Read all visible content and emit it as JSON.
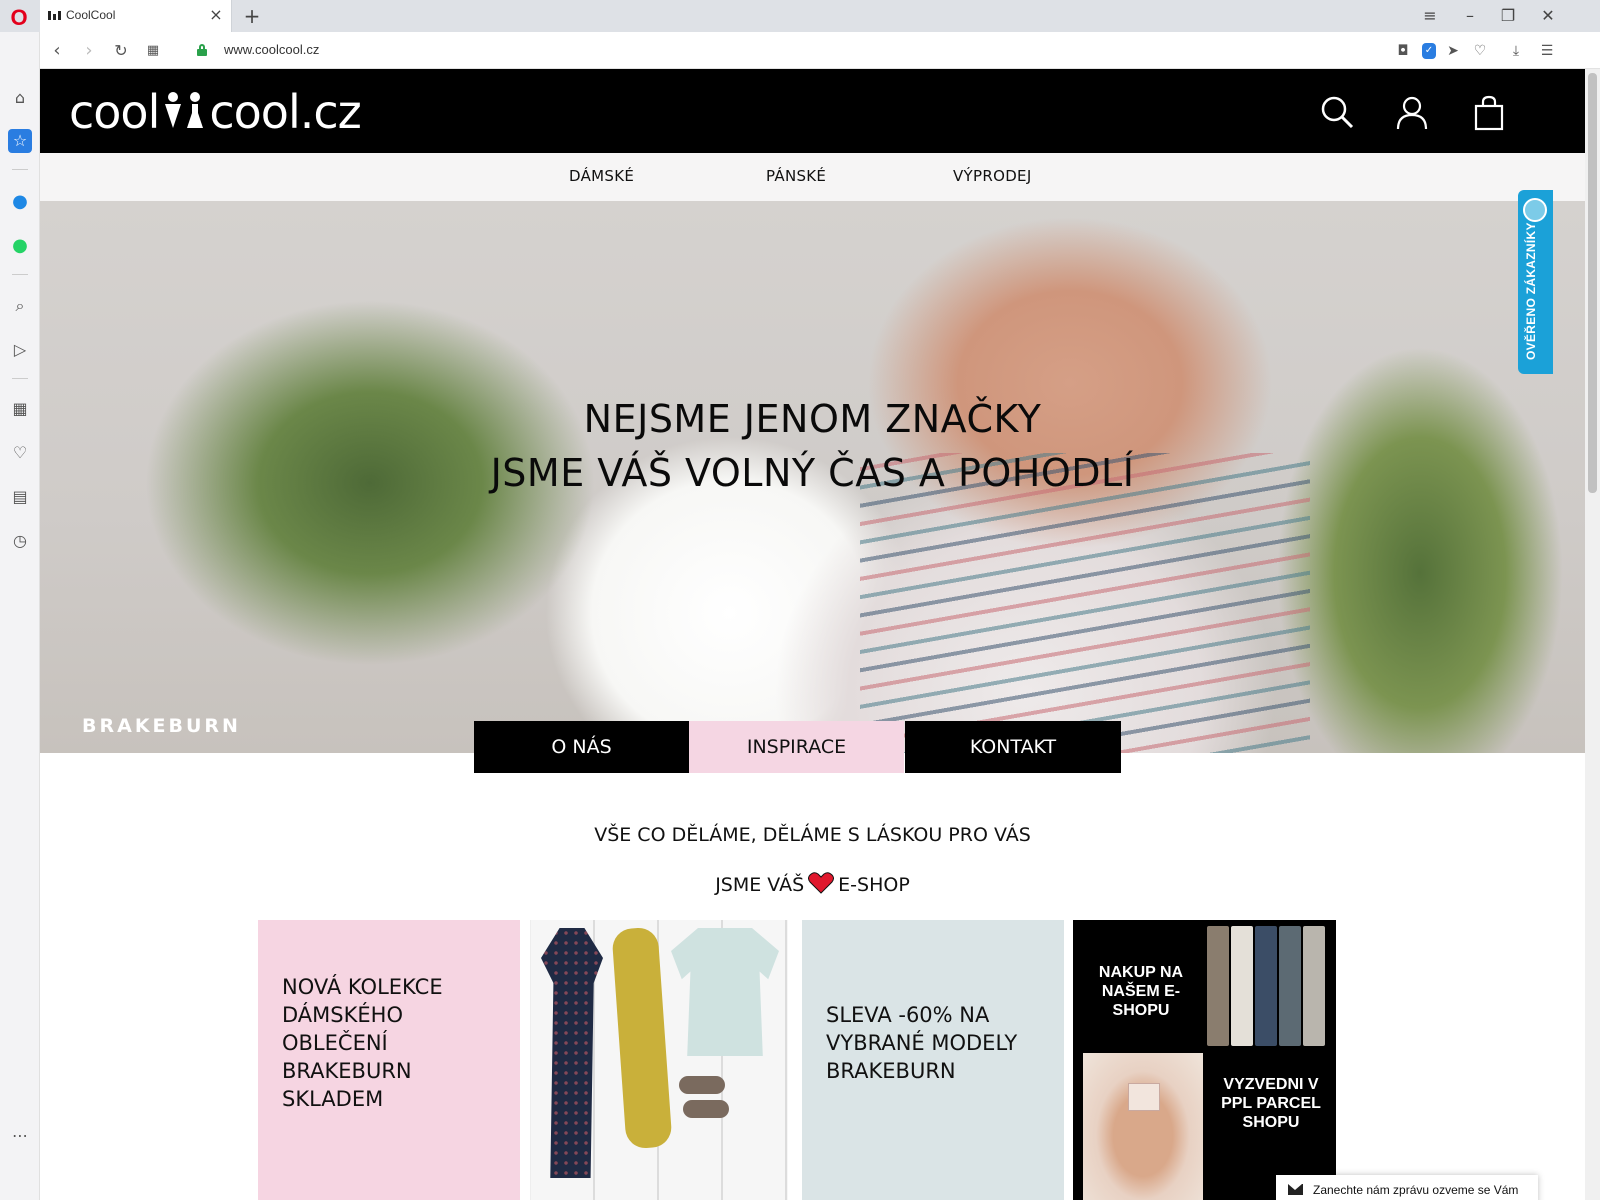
{
  "browser": {
    "tab_title": "CoolCool",
    "url": "www.coolcool.cz",
    "icons": {
      "opera": "opera-logo-icon",
      "back": "back-arrow-icon",
      "forward": "forward-arrow-icon",
      "reload": "reload-icon",
      "tabs": "tab-grid-icon",
      "lock": "lock-icon",
      "camera": "camera-icon",
      "vpn": "vpn-shield-icon",
      "send": "send-icon",
      "heart": "heart-icon",
      "download": "download-icon",
      "menu": "easy-setup-icon"
    },
    "sidebar_icons": [
      "home-icon",
      "speed-dial-icon",
      "messenger-icon",
      "whatsapp-icon",
      "search-icon",
      "send-icon",
      "extensions-icon",
      "bookmarks-heart-icon",
      "news-icon",
      "history-icon",
      "more-icon"
    ]
  },
  "site": {
    "logo_left": "cool",
    "logo_right": "cool.cz",
    "nav": [
      "DÁMSKÉ",
      "PÁNSKÉ",
      "VÝPRODEJ"
    ],
    "hero": {
      "title_line1": "NEJSME JENOM ZNAČKY",
      "title_line2": "JSME VÁŠ VOLNÝ ČAS A POHODLÍ",
      "brand_watermark": "BRAKEBURN"
    },
    "buttons": [
      "O NÁS",
      "INSPIRACE",
      "KONTAKT"
    ],
    "tagline1": "VŠE CO DĚLÁME, DĚLÁME S LÁSKOU PRO VÁS",
    "tagline2_before": "JSME VÁŠ",
    "tagline2_after": "E-SHOP",
    "tiles": {
      "pink_text": "NOVÁ KOLEKCE DÁMSKÉHO OBLEČENÍ BRAKEBURN SKLADEM",
      "blue_text": "SLEVA -60% NA VYBRANÉ MODELY BRAKEBURN",
      "black_top": "NAKUP NA NAŠEM E-SHOPU",
      "black_bottom": "VYZVEDNI V PPL PARCEL SHOPU"
    },
    "verified_widget": "OVĚŘENO ZÁKAZNÍKY",
    "chat": "Zanechte nám zprávu ozveme se Vám",
    "colors": {
      "header_bg": "#000000",
      "pink": "#f6d5e2",
      "blue_grey": "#dae4e6",
      "verified_blue": "#1ba1d8",
      "heart_red": "#e0182d"
    }
  }
}
